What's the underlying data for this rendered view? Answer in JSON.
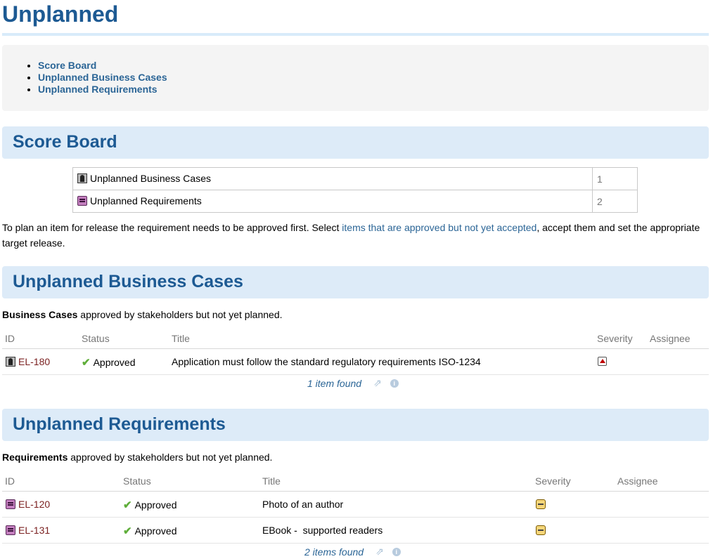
{
  "page": {
    "title": "Unplanned"
  },
  "toc": {
    "items": [
      "Score Board",
      "Unplanned Business Cases",
      "Unplanned Requirements"
    ]
  },
  "score_board": {
    "heading": "Score Board",
    "rows": [
      {
        "label": "Unplanned Business Cases",
        "count": "1",
        "icon": "business-case-icon"
      },
      {
        "label": "Unplanned Requirements",
        "count": "2",
        "icon": "requirement-icon"
      }
    ]
  },
  "note": {
    "prefix": "To plan an item for release the requirement needs to be approved first. Select ",
    "link": "items that are approved but not yet accepted",
    "suffix": ", accept them and set the appropriate target release."
  },
  "business_cases": {
    "heading": "Unplanned Business Cases",
    "desc_bold": "Business Cases",
    "desc_rest": " approved by stakeholders but not yet planned.",
    "columns": [
      "ID",
      "Status",
      "Title",
      "Severity",
      "Assignee"
    ],
    "rows": [
      {
        "id": "EL-180",
        "status": "Approved",
        "title": "Application must follow the standard regulatory requirements ISO-1234",
        "severity_icon": "severity-high-icon",
        "assignee": ""
      }
    ],
    "found": "1 item found"
  },
  "requirements": {
    "heading": "Unplanned Requirements",
    "desc_bold": "Requirements",
    "desc_rest": " approved by stakeholders but not yet planned.",
    "columns": [
      "ID",
      "Status",
      "Title",
      "Severity",
      "Assignee"
    ],
    "rows": [
      {
        "id": "EL-120",
        "status": "Approved",
        "title": "Photo of an author",
        "severity_icon": "severity-medium-icon",
        "assignee": ""
      },
      {
        "id": "EL-131",
        "status": "Approved",
        "title": "EBook -  supported readers",
        "severity_icon": "severity-medium-icon",
        "assignee": ""
      }
    ],
    "found": "2 items found"
  },
  "colors": {
    "heading": "#1d5a93",
    "link": "#2b6596",
    "section_bg": "#ddebf8",
    "id_link": "#7a1f1f",
    "approved_check": "#5fae3a"
  }
}
